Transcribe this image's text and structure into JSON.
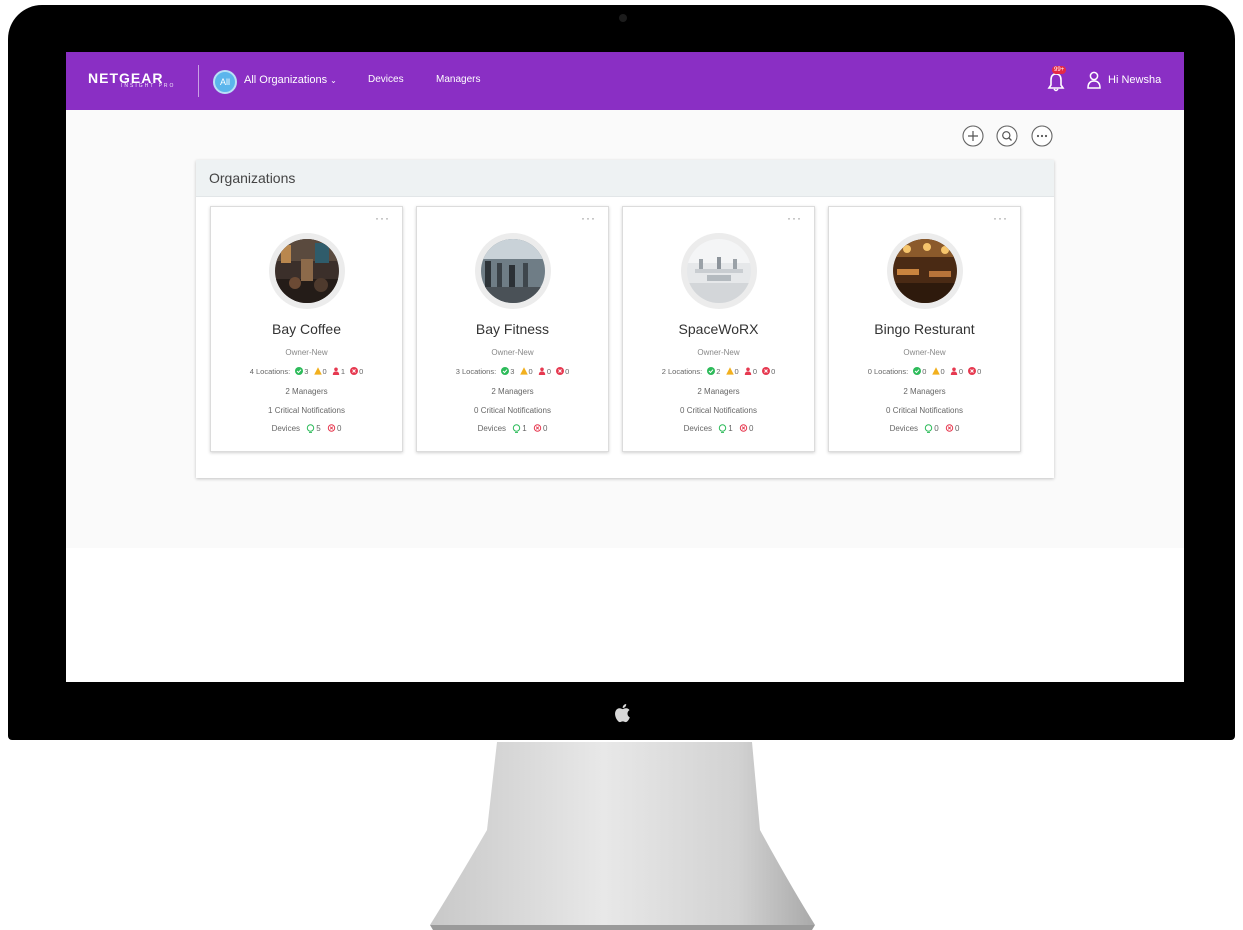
{
  "header": {
    "logo": "NETGEAR",
    "logo_sub": "INSIGHT PRO",
    "all_badge": "All",
    "org_selector": "All Organizations",
    "nav": [
      "Devices",
      "Managers"
    ],
    "notification_badge": "99+",
    "greeting": "Hi Newsha"
  },
  "actions": [
    "add-icon",
    "search-icon",
    "more-icon"
  ],
  "panel": {
    "title": "Organizations",
    "cards": [
      {
        "name": "Bay Coffee",
        "owner": "Owner-New",
        "locations_label": "4 Locations:",
        "ok": "3",
        "warn": "0",
        "user_alert": "1",
        "critical": "0",
        "managers": "2 Managers",
        "notifications": "1 Critical Notifications",
        "devices_label": "Devices",
        "devices_online": "5",
        "devices_offline": "0",
        "more": "···"
      },
      {
        "name": "Bay Fitness",
        "owner": "Owner-New",
        "locations_label": "3 Locations:",
        "ok": "3",
        "warn": "0",
        "user_alert": "0",
        "critical": "0",
        "managers": "2 Managers",
        "notifications": "0 Critical Notifications",
        "devices_label": "Devices",
        "devices_online": "1",
        "devices_offline": "0",
        "more": "···"
      },
      {
        "name": "SpaceWoRX",
        "owner": "Owner-New",
        "locations_label": "2 Locations:",
        "ok": "2",
        "warn": "0",
        "user_alert": "0",
        "critical": "0",
        "managers": "2 Managers",
        "notifications": "0 Critical Notifications",
        "devices_label": "Devices",
        "devices_online": "1",
        "devices_offline": "0",
        "more": "···"
      },
      {
        "name": "Bingo Resturant",
        "owner": "Owner-New",
        "locations_label": "0 Locations:",
        "ok": "0",
        "warn": "0",
        "user_alert": "0",
        "critical": "0",
        "managers": "2 Managers",
        "notifications": "0 Critical Notifications",
        "devices_label": "Devices",
        "devices_online": "0",
        "devices_offline": "0",
        "more": "···"
      }
    ]
  },
  "colors": {
    "header_bg": "#8a2fc4",
    "ok_green": "#2dbb5a",
    "warn_yellow": "#f2b01e",
    "alert_red": "#e63950",
    "badge_blue": "#5bb5ec"
  }
}
